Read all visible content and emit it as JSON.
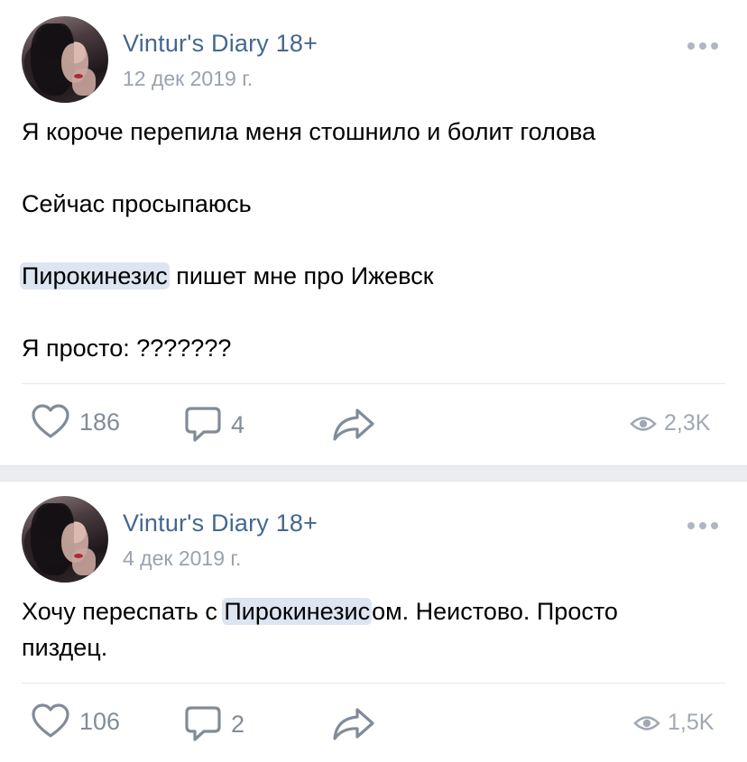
{
  "posts": [
    {
      "author": "Vintur's Diary 18+",
      "date": "12 дек 2019 г.",
      "lines": {
        "l1": "Я короче перепила меня стошнило и болит голова",
        "l2": "Сейчас просыпаюсь",
        "l3_mention": "Пирокинезис",
        "l3_rest": " пишет мне про Ижевск",
        "l4": "Я просто: ???????"
      },
      "likes": "186",
      "comments": "4",
      "views": "2,3K"
    },
    {
      "author": "Vintur's Diary 18+",
      "date": "4 дек 2019 г.",
      "lines": {
        "l1_pre": "Хочу переспать с ",
        "l1_mention": "Пирокинезис",
        "l1_post": "ом. Неистово. Просто",
        "l2": "пиздец."
      },
      "likes": "106",
      "comments": "2",
      "views": "1,5K"
    }
  ],
  "icons": {
    "like": "heart-icon",
    "comment": "comment-icon",
    "share": "share-icon",
    "views": "eye-icon",
    "more": "more-dots-icon"
  },
  "colors": {
    "author": "#45678f",
    "secondary": "#99a2ad",
    "action": "#818c99",
    "mention_bg": "#dde5f0",
    "separator": "#ebedf0"
  }
}
